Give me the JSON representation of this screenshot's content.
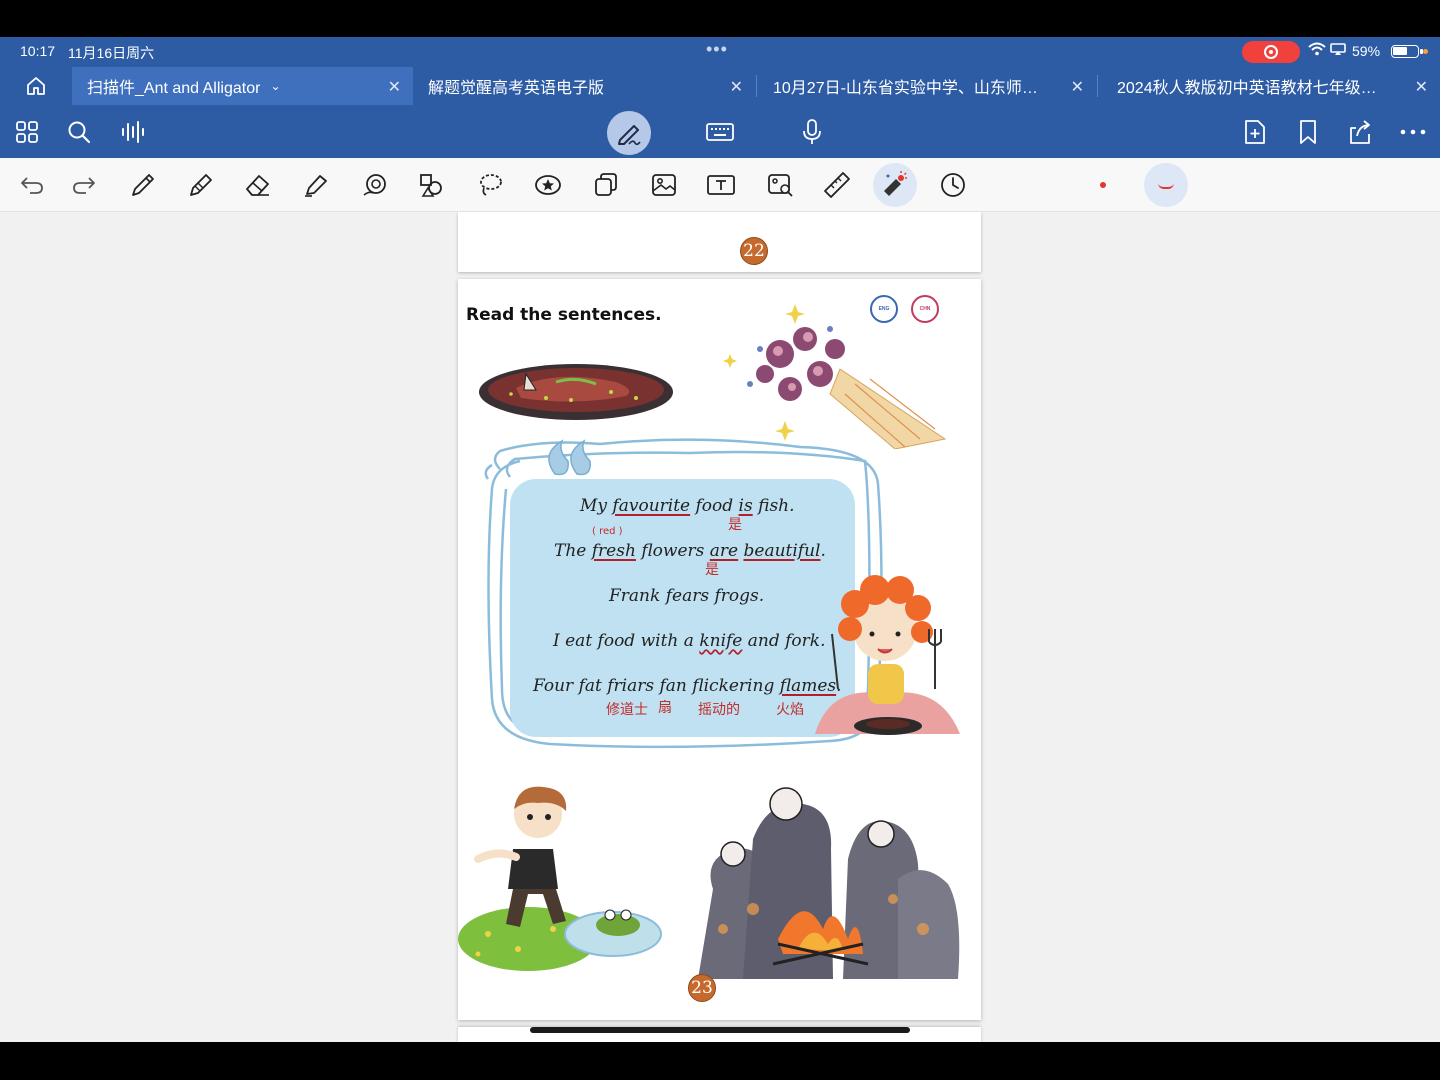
{
  "status": {
    "time": "10:17",
    "date": "11月16日周六",
    "battery": "59%",
    "battery_level": 0.59
  },
  "tabs": [
    {
      "title": "扫描件_Ant and Alligator",
      "active": true
    },
    {
      "title": "解题觉醒高考英语电子版",
      "active": false
    },
    {
      "title": "10月27日-山东省实验中学、山东师…",
      "active": false
    },
    {
      "title": "2024秋人教版初中英语教材七年级…",
      "active": false
    }
  ],
  "icons": {
    "top_toolbar": [
      "grid-icon",
      "search-icon",
      "audio-icon",
      "pen-mode-icon",
      "keyboard-icon",
      "microphone-icon",
      "add-page-icon",
      "bookmark-icon",
      "share-icon",
      "more-icon"
    ],
    "tools": [
      "undo-icon",
      "redo-icon",
      "pen-icon",
      "pencil-icon",
      "eraser-icon",
      "highlighter-icon",
      "shape-icon",
      "shapes-icon",
      "lasso-icon",
      "sticker-icon",
      "copy-icon",
      "image-icon",
      "text-icon",
      "image-search-icon",
      "ruler-icon",
      "laser-icon",
      "timer-icon"
    ]
  },
  "colors": {
    "brand": "#2d5ca5",
    "ink": "#e4342e"
  },
  "document": {
    "prev_page_number": "22",
    "page_number": "23",
    "heading": "Read the sentences.",
    "lang_en": "ENG",
    "lang_cn": "CHN",
    "sentences": {
      "s1": {
        "a": "My ",
        "b": "favourite",
        "c": " food ",
        "d": "is",
        "e": " fish."
      },
      "s2": {
        "a": "The ",
        "b": "fresh",
        "c": " flowers ",
        "d": "are",
        "e": " ",
        "f": "beautiful",
        "g": "."
      },
      "s3": {
        "a": "Frank fears frogs."
      },
      "s4": {
        "a": "I eat food with a ",
        "b": "knife",
        "c": " and fork."
      },
      "s5": {
        "a": "Four fat friars fan flickering ",
        "b": "flames",
        "c": "."
      }
    },
    "annotations": {
      "is_note": "是",
      "red_note": "( red )",
      "are_note": "是",
      "friars_note": "修道士",
      "fan_note": "扇",
      "flickering_note": "摇动的",
      "flames_note": "火焰"
    }
  }
}
